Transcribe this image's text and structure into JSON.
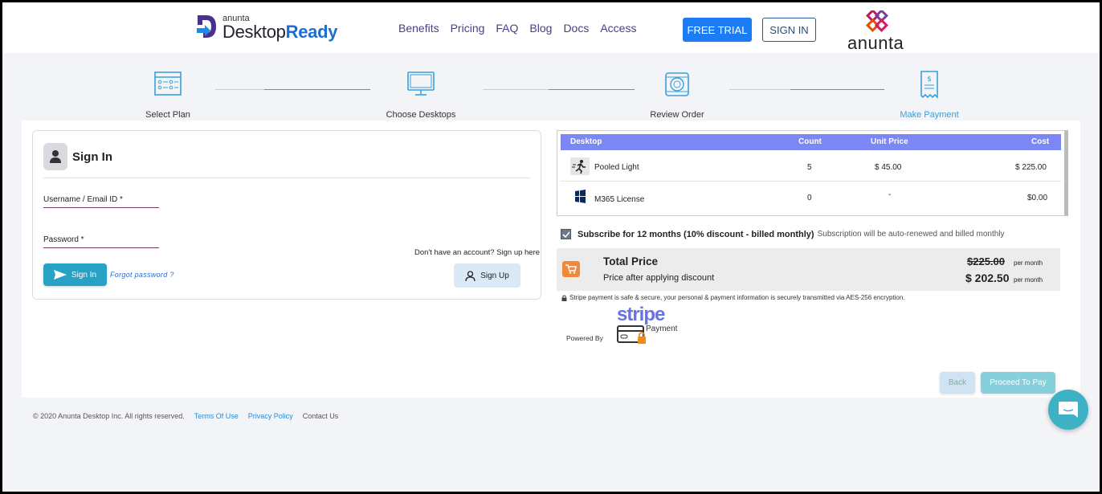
{
  "header": {
    "logo": {
      "small": "anunta",
      "main_a": "Desktop",
      "main_b": "Ready"
    },
    "nav": [
      "Benefits",
      "Pricing",
      "FAQ",
      "Blog",
      "Docs",
      "Access"
    ],
    "free_trial": "FREE TRIAL",
    "sign_in": "SIGN IN",
    "brand": "anunta"
  },
  "steps": [
    {
      "label": "Select Plan"
    },
    {
      "label": "Choose Desktops"
    },
    {
      "label": "Review Order"
    },
    {
      "label": "Make Payment",
      "active": true
    }
  ],
  "signin": {
    "title": "Sign In",
    "username_label": "Username / Email ID *",
    "password_label": "Password *",
    "signin_button": "Sign In",
    "forgot": "Forgot password ?",
    "no_account": "Don't have an account? Sign up here",
    "signup_button": "Sign Up"
  },
  "order": {
    "columns": [
      "Desktop",
      "Count",
      "Unit Price",
      "Cost"
    ],
    "rows": [
      {
        "icon": "running-person-icon",
        "desktop": "Pooled Light",
        "count": "5",
        "unit_price": "$ 45.00",
        "cost": "$ 225.00"
      },
      {
        "icon": "windows-icon",
        "desktop": "M365 License",
        "count": "0",
        "unit_price": "-",
        "cost": "$0.00"
      }
    ]
  },
  "subscribe": {
    "checked": true,
    "label": "Subscribe for 12 months (10% discount - billed monthly)",
    "note": "Subscription will be auto-renewed and billed monthly"
  },
  "price": {
    "total_label": "Total Price",
    "discount_label": "Price after applying discount",
    "old_price": "$225.00",
    "new_price": "$ 202.50",
    "per_month": "per month"
  },
  "secure_note": "Stripe payment is safe & secure, your personal & payment information is securely transmitted via AES-256 encryption.",
  "powered_by": "Powered By",
  "stripe": {
    "word": "stripe",
    "payment": "Payment"
  },
  "actions": {
    "back": "Back",
    "proceed": "Proceed To Pay"
  },
  "footer": {
    "copyright": "© 2020 Anunta Desktop Inc. All rights reserved.",
    "terms": "Terms Of Use",
    "privacy": "Privacy Policy",
    "contact": "Contact Us"
  },
  "colors": {
    "accent": "#1b7cf5",
    "table_header": "#7b87f5",
    "teal": "#27a2c5",
    "step_active": "#3aa0d8"
  }
}
